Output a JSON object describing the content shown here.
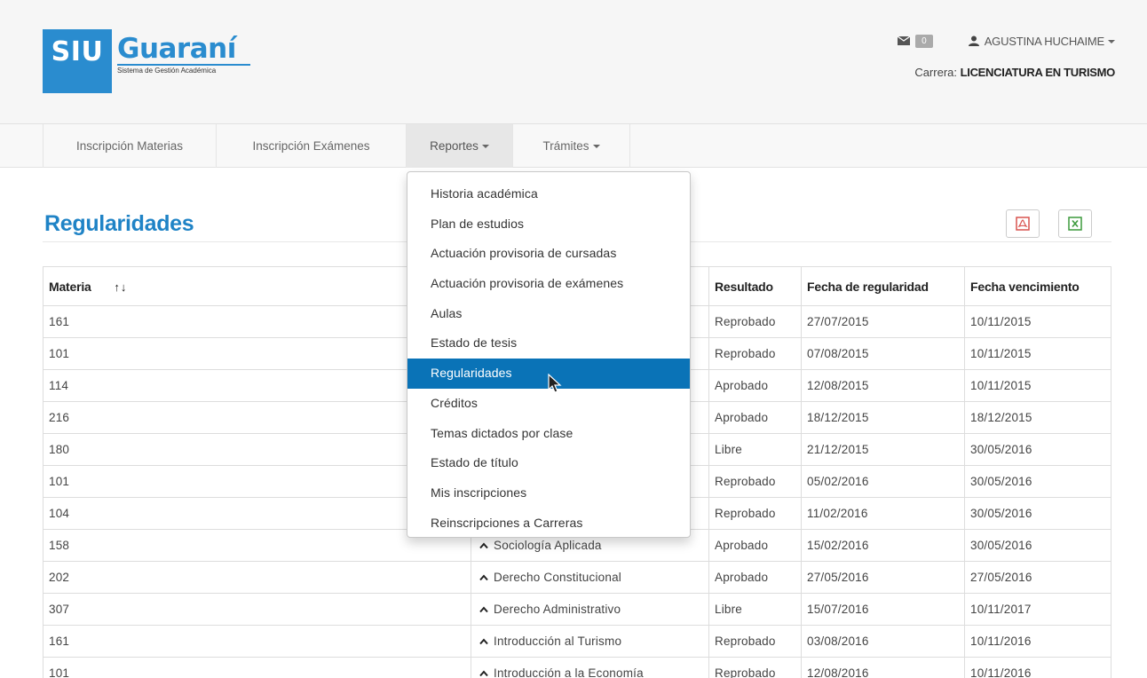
{
  "logo": {
    "siu": "SIU",
    "name": "Guaraní",
    "subtitle": "Sistema de Gestión Académica"
  },
  "header": {
    "mail_count": "0",
    "user_name": "AGUSTINA HUCHAIME",
    "career_label": "Carrera:",
    "career_value": "LICENCIATURA EN TURISMO"
  },
  "nav": {
    "items": [
      {
        "label": "Inscripción Materias"
      },
      {
        "label": "Inscripción Exámenes"
      },
      {
        "label": "Reportes"
      },
      {
        "label": "Trámites"
      }
    ]
  },
  "dropdown": {
    "items": [
      "Historia académica",
      "Plan de estudios",
      "Actuación provisoria de cursadas",
      "Actuación provisoria de exámenes",
      "Aulas",
      "Estado de tesis",
      "Regularidades",
      "Créditos",
      "Temas dictados por clase",
      "Estado de título",
      "Mis inscripciones",
      "Reinscripciones a Carreras"
    ],
    "active_index": 6
  },
  "page": {
    "title": "Regularidades"
  },
  "table": {
    "headers": {
      "materia": "Materia",
      "sort": "↑↓",
      "resultado": "Resultado",
      "fecha_regularidad": "Fecha de regularidad",
      "fecha_vencimiento": "Fecha vencimiento"
    },
    "rows": [
      {
        "code": "161",
        "name": "",
        "result": "Reprobado",
        "date": "27/07/2015",
        "expires": "10/11/2015"
      },
      {
        "code": "101",
        "name": "",
        "result": "Reprobado",
        "date": "07/08/2015",
        "expires": "10/11/2015"
      },
      {
        "code": "114",
        "name": "",
        "result": "Aprobado",
        "date": "12/08/2015",
        "expires": "10/11/2015"
      },
      {
        "code": "216",
        "name": "",
        "result": "Aprobado",
        "date": "18/12/2015",
        "expires": "18/12/2015"
      },
      {
        "code": "180",
        "name": "",
        "result": "Libre",
        "date": "21/12/2015",
        "expires": "30/05/2016"
      },
      {
        "code": "101",
        "name": "",
        "result": "Reprobado",
        "date": "05/02/2016",
        "expires": "30/05/2016"
      },
      {
        "code": "104",
        "name": "",
        "result": "Reprobado",
        "date": "11/02/2016",
        "expires": "30/05/2016"
      },
      {
        "code": "158",
        "name": "Sociología Aplicada",
        "result": "Aprobado",
        "date": "15/02/2016",
        "expires": "30/05/2016"
      },
      {
        "code": "202",
        "name": "Derecho Constitucional",
        "result": "Aprobado",
        "date": "27/05/2016",
        "expires": "27/05/2016"
      },
      {
        "code": "307",
        "name": "Derecho Administrativo",
        "result": "Libre",
        "date": "15/07/2016",
        "expires": "10/11/2017"
      },
      {
        "code": "161",
        "name": "Introducción al Turismo",
        "result": "Reprobado",
        "date": "03/08/2016",
        "expires": "10/11/2016"
      },
      {
        "code": "101",
        "name": "Introducción a la Economía",
        "result": "Reprobado",
        "date": "12/08/2016",
        "expires": "10/11/2016"
      }
    ]
  },
  "colors": {
    "brand": "#2a8ccf",
    "title": "#1f83c6",
    "active_menu": "#0a73b7",
    "pdf": "#d9534f",
    "excel": "#3c9a3c"
  },
  "icons": [
    "envelope-icon",
    "user-icon",
    "caret-down-icon",
    "pdf-icon",
    "excel-icon",
    "sort-icon",
    "chevron-up-icon",
    "mouse-pointer-icon"
  ]
}
